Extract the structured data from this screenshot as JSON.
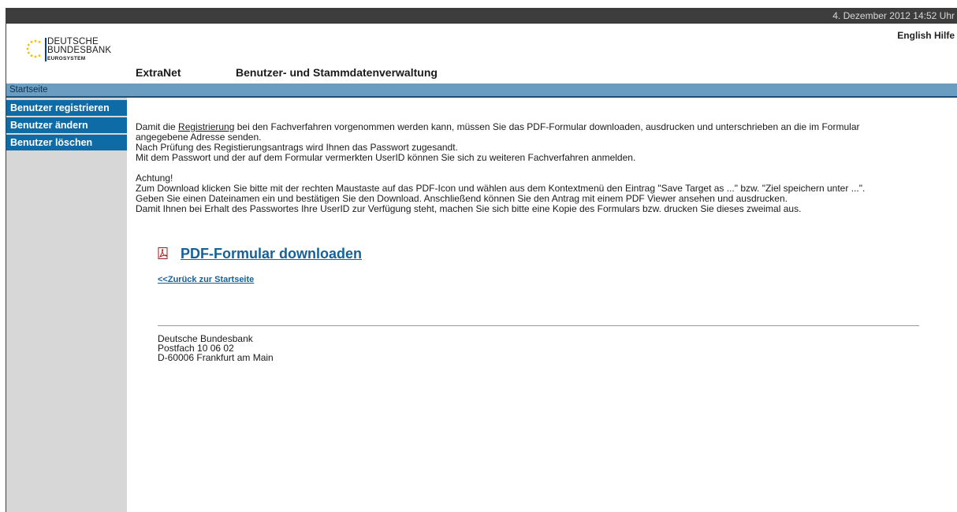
{
  "topbar": {
    "datetime": "4. Dezember 2012 14:52 Uhr"
  },
  "header": {
    "links": [
      "English",
      "Hilfe"
    ],
    "logo": {
      "line1": "DEUTSCHE",
      "line2": "BUNDESBANK",
      "line3": "EUROSYSTEM"
    },
    "app_name": "ExtraNet",
    "app_title": "Benutzer- und Stammdatenverwaltung"
  },
  "breadcrumb": {
    "label": "Startseite"
  },
  "sidebar": {
    "items": [
      {
        "label": "Benutzer registrieren"
      },
      {
        "label": "Benutzer ändern"
      },
      {
        "label": "Benutzer löschen"
      }
    ]
  },
  "main": {
    "para1_pre": "Damit die ",
    "para1_link": "Registrierung",
    "para1_post": " bei den Fachverfahren vorgenommen werden kann, müssen Sie das PDF-Formular downloaden, ausdrucken und unterschrieben an die im Formular",
    "para1_line2": "angegebene Adresse senden.",
    "para1_line3": "Nach Prüfung des Registierungsantrags wird Ihnen das Passwort zugesandt.",
    "para1_line4": "Mit dem Passwort und der auf dem Formular vermerkten UserID können Sie sich zu weiteren Fachverfahren anmelden.",
    "warn_title": "Achtung!",
    "warn_line1": "Zum Download klicken Sie bitte mit der rechten Maustaste auf das PDF-Icon und wählen aus dem Kontextmenü den Eintrag \"Save Target as ...\" bzw. \"Ziel speichern unter ...\".",
    "warn_line2": "Geben Sie einen Dateinamen ein und bestätigen Sie den Download. Anschließend können Sie den Antrag mit einem PDF Viewer ansehen und ausdrucken.",
    "warn_line3": "Damit Ihnen bei Erhalt des Passwortes Ihre UserID zur Verfügung steht, machen Sie sich bitte eine Kopie des Formulars bzw. drucken Sie dieses zweimal aus.",
    "pdf_link": "PDF-Formular downloaden",
    "pdf_icon": "pdf-icon",
    "back_link": "<<Zurück zur Startseite"
  },
  "footer": {
    "line1": "Deutsche Bundesbank",
    "line2": "Postfach 10 06 02",
    "line3": "D-60006 Frankfurt am Main"
  },
  "colors": {
    "topbar": "#3d3d3d",
    "nav": "#0f6ba6",
    "breadcrumb": "#6b9dc0",
    "sidebar": "#d7d7d7",
    "link": "#15629a"
  }
}
